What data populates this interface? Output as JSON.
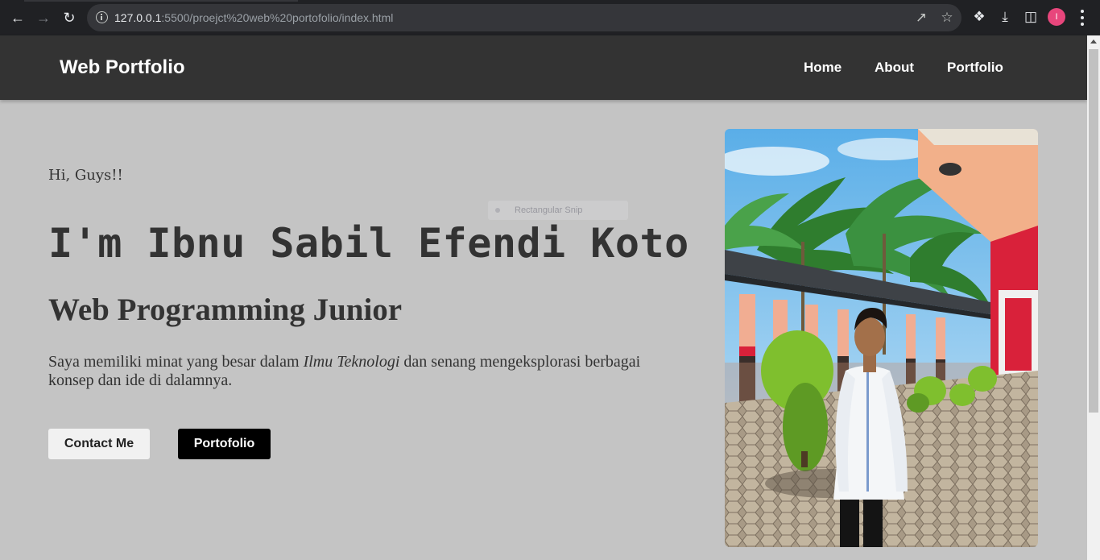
{
  "browser": {
    "url_host": "127.0.0.1",
    "url_rest": ":5500/proejct%20web%20portofolio/index.html",
    "profile_initial": "I"
  },
  "site": {
    "logo": "Web Portfolio",
    "nav": [
      {
        "label": "Home"
      },
      {
        "label": "About"
      },
      {
        "label": "Portfolio"
      }
    ]
  },
  "hero": {
    "greeting": "Hi, Guys!!",
    "name": "I'm Ibnu Sabil Efendi Koto",
    "role": "Web Programming Junior",
    "desc_before": "Saya memiliki minat yang besar dalam ",
    "desc_em": "Ilmu Teknologi",
    "desc_after": " dan senang mengeksplorasi berbagai konsep dan ide di dalamnya.",
    "buttons": {
      "contact": "Contact Me",
      "portfolio": "Portofolio"
    }
  },
  "overlay": {
    "snip_label": "Rectangular Snip"
  },
  "colors": {
    "page_bg": "#c4c4c4",
    "header_bg": "#333333",
    "text": "#333333",
    "accent_profile": "#e8467c"
  }
}
